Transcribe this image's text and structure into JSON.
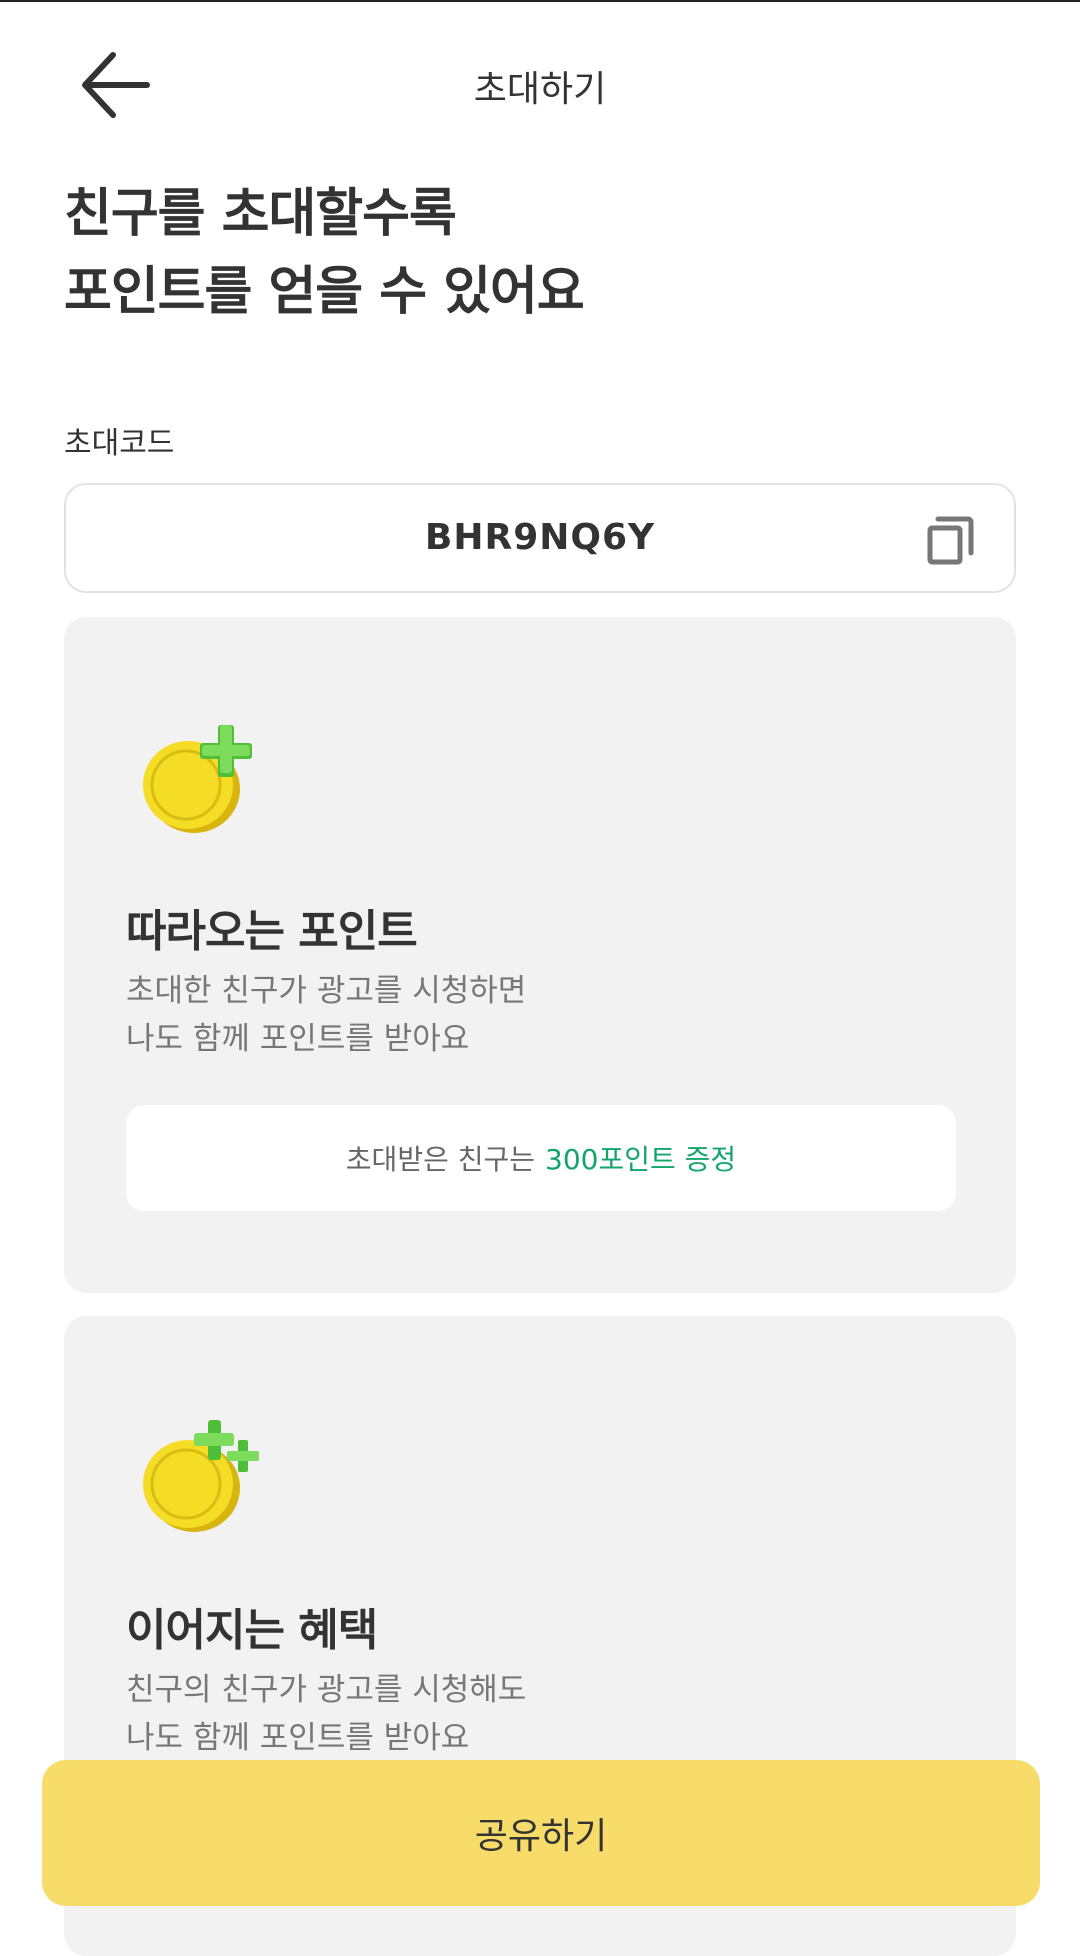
{
  "header": {
    "title": "초대하기",
    "back_icon": "arrow-left-icon"
  },
  "headline": {
    "line1": "친구를 초대할수록",
    "line2": "포인트를 얻을 수 있어요"
  },
  "invite_code": {
    "label": "초대코드",
    "value": "BHR9NQ6Y",
    "copy_icon": "copy-icon"
  },
  "cards": [
    {
      "icon": "coin-plus-icon",
      "title": "따라오는 포인트",
      "desc_line1": "초대한 친구가 광고를 시청하면",
      "desc_line2": "나도 함께 포인트를 받아요",
      "reward_prefix": "초대받은 친구는",
      "reward_highlight": "300포인트 증정"
    },
    {
      "icon": "coin-double-plus-icon",
      "title": "이어지는 혜택",
      "desc_line1": "친구의 친구가 광고를 시청해도",
      "desc_line2": "나도 함께 포인트를 받아요"
    }
  ],
  "share_button": {
    "label": "공유하기"
  },
  "colors": {
    "accent_yellow": "#f8dc6a",
    "highlight_green": "#14a56c",
    "card_bg": "#f2f2f2"
  }
}
